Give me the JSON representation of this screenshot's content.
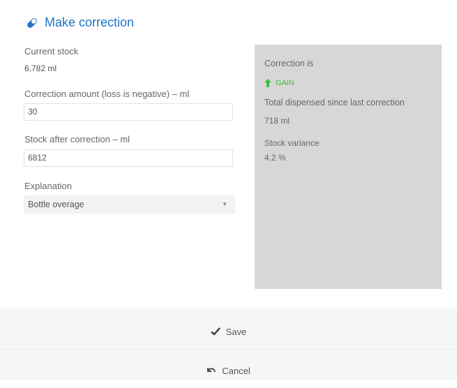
{
  "dialog": {
    "title": "Make correction"
  },
  "form": {
    "current_stock_label": "Current stock",
    "current_stock_value": "6,782  ml",
    "correction_label": "Correction amount (loss is negative) – ml",
    "correction_value": "30",
    "after_label": "Stock after correction – ml",
    "after_value": "6812",
    "explanation_label": "Explanation",
    "explanation_value": "Bottle overage"
  },
  "info": {
    "correction_is_label": "Correction is",
    "gain_text": "GAIN",
    "dispensed_label": "Total dispensed since last correction",
    "dispensed_value": "718  ml",
    "variance_label": "Stock variance",
    "variance_value": "4.2 %",
    "gain_color": "#3cbf3c"
  },
  "footer": {
    "save_label": "Save",
    "cancel_label": "Cancel"
  },
  "colors": {
    "accent": "#1f74c5",
    "info_bg": "#d7d7d7",
    "footer_bg": "#f6f6f6"
  }
}
